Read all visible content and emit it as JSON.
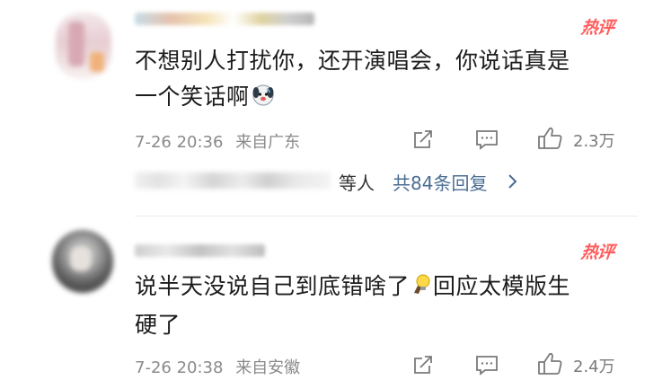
{
  "comments": [
    {
      "hot_tag": "热评",
      "text_lines": [
        "不想别人打扰你，还开演唱会，你说话真是",
        "一个笑话啊"
      ],
      "time": "7-26 20:36",
      "location": "来自广东",
      "likes": "2.3万",
      "replies": {
        "who": "等人",
        "link": "共84条回复"
      }
    },
    {
      "hot_tag": "热评",
      "text_lines": [
        "说半天没说自己到底错啥了",
        "回应太模版生",
        "硬了"
      ],
      "time": "7-26 20:38",
      "location": "来自安徽",
      "likes": "2.4万"
    }
  ],
  "icons": {
    "share": "share-icon",
    "comment": "comment-icon",
    "like": "thumbs-up-icon",
    "emoji_1": "dog-emoji-icon",
    "emoji_2": "lightbulb-emoji-icon",
    "chevron": "chevron-right-icon"
  },
  "colors": {
    "hot_tag": "#ff5d5d",
    "link": "#4a6d93",
    "meta": "#8a8a8a"
  }
}
